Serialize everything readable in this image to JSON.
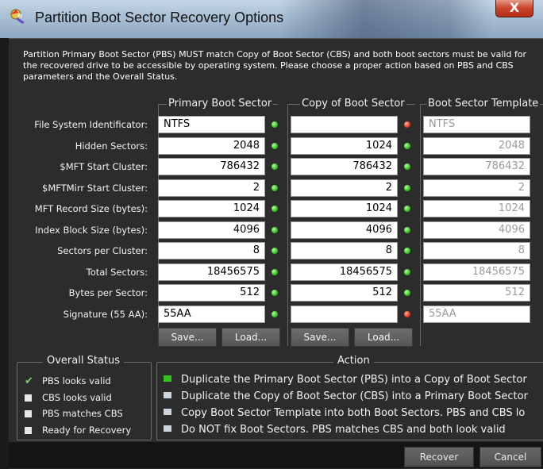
{
  "window": {
    "title": "Partition Boot Sector Recovery Options",
    "close_label": "X"
  },
  "intro": "Partition Primary Boot Sector (PBS) MUST match Copy of Boot Sector (CBS) and both boot sectors must be valid for the recovered drive to be accessible by operating system. Please choose a proper action based on PBS and CBS parameters and the Overall Status.",
  "columns": {
    "pbs": "Primary Boot Sector",
    "cbs": "Copy of Boot Sector",
    "template": "Boot Sector Template"
  },
  "rows": [
    {
      "label": "File System Identificator:",
      "pbs": "NTFS",
      "pbs_status": "valid",
      "cbs": "",
      "cbs_status": "invalid",
      "template": "NTFS"
    },
    {
      "label": "Hidden Sectors:",
      "pbs": "2048",
      "pbs_status": "valid",
      "cbs": "1024",
      "cbs_status": "valid",
      "template": "2048"
    },
    {
      "label": "$MFT Start Cluster:",
      "pbs": "786432",
      "pbs_status": "valid",
      "cbs": "786432",
      "cbs_status": "valid",
      "template": "786432"
    },
    {
      "label": "$MFTMirr Start Cluster:",
      "pbs": "2",
      "pbs_status": "valid",
      "cbs": "2",
      "cbs_status": "valid",
      "template": "2"
    },
    {
      "label": "MFT Record Size (bytes):",
      "pbs": "1024",
      "pbs_status": "valid",
      "cbs": "1024",
      "cbs_status": "valid",
      "template": "1024"
    },
    {
      "label": "Index Block Size (bytes):",
      "pbs": "4096",
      "pbs_status": "valid",
      "cbs": "4096",
      "cbs_status": "valid",
      "template": "4096"
    },
    {
      "label": "Sectors per Cluster:",
      "pbs": "8",
      "pbs_status": "valid",
      "cbs": "8",
      "cbs_status": "valid",
      "template": "8"
    },
    {
      "label": "Total Sectors:",
      "pbs": "18456575",
      "pbs_status": "valid",
      "cbs": "18456575",
      "cbs_status": "valid",
      "template": "18456575"
    },
    {
      "label": "Bytes per Sector:",
      "pbs": "512",
      "pbs_status": "valid",
      "cbs": "512",
      "cbs_status": "valid",
      "template": "512"
    },
    {
      "label": "Signature (55 AA):",
      "pbs": "55AA",
      "pbs_status": "valid",
      "cbs": "",
      "cbs_status": "invalid",
      "template": "55AA"
    }
  ],
  "buttons": {
    "save": "Save...",
    "load": "Load..."
  },
  "overall_status": {
    "title": "Overall Status",
    "items": [
      {
        "label": "PBS looks valid",
        "checked": true
      },
      {
        "label": "CBS looks valid",
        "checked": false
      },
      {
        "label": "PBS matches CBS",
        "checked": false
      },
      {
        "label": "Ready for Recovery",
        "checked": false
      }
    ]
  },
  "action": {
    "title": "Action",
    "options": [
      {
        "label": "Duplicate the Primary Boot Sector (PBS) into a Copy of Boot Sector",
        "selected": true
      },
      {
        "label": "Duplicate the Copy of Boot Sector (CBS) into a Primary Boot Sector",
        "selected": false
      },
      {
        "label": "Copy Boot Sector Template into both Boot Sectors. PBS and CBS lo",
        "selected": false
      },
      {
        "label": "Do NOT fix Boot Sectors. PBS matches CBS and both look valid",
        "selected": false
      }
    ]
  },
  "footer": {
    "recover": "Recover",
    "cancel": "Cancel"
  },
  "colors": {
    "status_valid": "#33c21e",
    "status_invalid": "#e6351d",
    "window_bg": "#2c2c2c"
  },
  "icons": {
    "app": "recovery-app-icon",
    "close": "close-icon",
    "check": "checkmark-icon"
  }
}
